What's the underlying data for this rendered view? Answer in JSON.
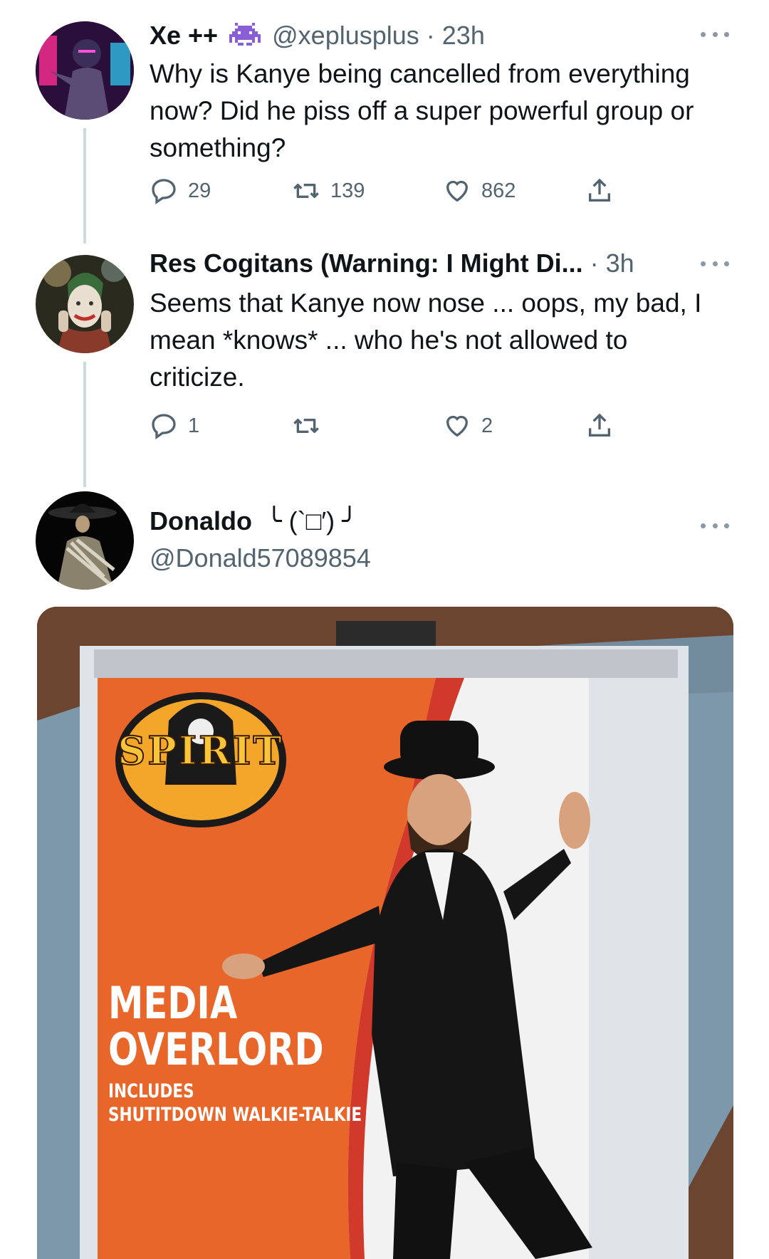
{
  "tweets": [
    {
      "name": "Xe ++",
      "handle": "@xeplusplus",
      "time": "23h",
      "badge_icon": "alien-monster-icon",
      "text": "Why is Kanye being cancelled from everything now? Did he piss off a super powerful group or something?",
      "replies": "29",
      "retweets": "139",
      "likes": "862"
    },
    {
      "name": "Res Cogitans (Warning: I Might Di...",
      "time": "3h",
      "text": "Seems that Kanye now nose ... oops, my bad, I mean *knows* ... who he's not allowed to criticize.",
      "replies": "1",
      "retweets": "",
      "likes": "2"
    },
    {
      "name": "Donaldo",
      "name_suffix": "╰ (`□′) ╯",
      "handle": "@Donald57089854"
    }
  ],
  "media": {
    "brand": "SPIRIT",
    "title_line1": "MEDIA",
    "title_line2": "OVERLORD",
    "includes_label": "INCLUDES",
    "includes_item": "SHUTITDOWN WALKIE-TALKIE"
  },
  "colors": {
    "muted": "#536471",
    "thread_line": "#cfd9de",
    "package_orange": "#e8662a"
  }
}
